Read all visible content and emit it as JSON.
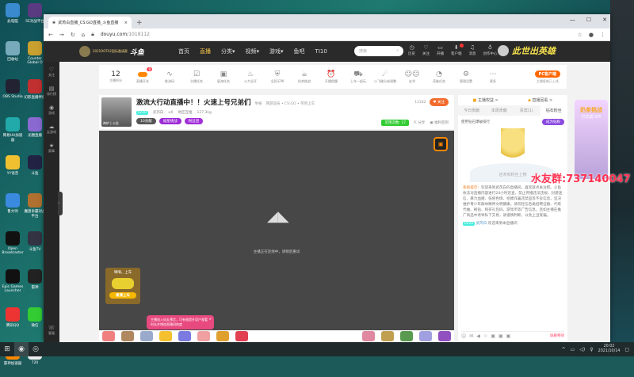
{
  "desktop": {
    "icons": [
      "此电脑",
      "5E对战平台",
      "回收站",
      "Counter Global O",
      "OBS Studio",
      "幻影直播伴侣",
      "网易UU加速器",
      "光圈直播",
      "YY语音",
      "斗鱼",
      "鲁大师",
      "魔兽争霸对战平台",
      "Open Broadcaster",
      "斗鱼TV",
      "Epic Games Launcher",
      "雷神",
      "腾讯QQ",
      "微信",
      "雷神加速器",
      "720"
    ]
  },
  "browser": {
    "tab_title": "武芮白直播_CS:GO直播_斗鱼直播",
    "url_domain": "douyu.com",
    "url_path": "/1019112",
    "new_tab": "+"
  },
  "site": {
    "nav": [
      "首页",
      "直播",
      "分类",
      "视频",
      "游戏",
      "鱼吧",
      "TI10"
    ],
    "logo_text": "2021DOTA2国际邀请赛",
    "logo_brand": "斗鱼",
    "search_placeholder": "搜索",
    "user_icons": [
      "历史",
      "关注",
      "开播",
      "客户端",
      "消息",
      "创作中心"
    ],
    "brand_slogan": "此世出英雄",
    "side": [
      "关注",
      "排行榜",
      "游戏",
      "云游戏",
      "赛事",
      "客服"
    ],
    "toolbar": {
      "score": "12",
      "score_label": "主播积分",
      "toggle_badge": "9",
      "items": [
        "直播开关",
        "推流码",
        "主播任务",
        "星海任务",
        "火力全开",
        "全民乐PK",
        "奶茶挑战",
        "开播提醒",
        "上车一起玩",
        "小飞碟分成调整",
        "友邻",
        "亮能任务",
        "管理设置",
        "更多"
      ],
      "pc_button": "PC客户端",
      "pc_sub": "主播版制已上线"
    }
  },
  "room": {
    "title": "激流大行动直播中！！火速上号兄弟们",
    "report": "举报",
    "category": "网游竞技 • CS:GO • 带到上车",
    "level": "LV20",
    "streamer": "武芮白",
    "hot": "0",
    "rank": "地区互推",
    "weight": "127.3kg",
    "fans_count": "12182",
    "follow": "关注",
    "thumb_label": "神护 | 公告",
    "tags": [
      "10贡献",
      "福星挑战",
      "粉丝团"
    ],
    "chance": "可用次数: 17",
    "share": "分享",
    "client": "福利签到"
  },
  "video": {
    "status": "主播正在连线中，请稍后重试",
    "car_title": "嘀嘀，上车",
    "car_btn": "邀请上车",
    "tip": "主播加入仙丸预言，可有效提升用户观看时长并增加直播间热度"
  },
  "panel": {
    "top": [
      "主播权益 >",
      "直播回看 >"
    ],
    "tabs": [
      "今日贡献",
      "本周贡献",
      "贵宾(1)",
      "钻石粉丝"
    ],
    "rank_label": "使用钻石爆破排行",
    "rank_btn": "成为钻粉",
    "empty": "还未有粉丝上榜",
    "chat": {
      "sys_label": "系统提示：",
      "sys_text": "欢迎来到武芮白的直播间。喜欢就点关注吧。斗鱼依法对直播内容进行24小时巡查，禁止传播违法违规、封建迷信、暴力血腥、低俗色情、招嫖诈骗违禁品等不良信息，坚决维护青少年群体精神文明健康。请勿轻信各类招聘征婚、代练代抽、刷钻、购买礼包码、游戏币等广告信息，且如主播在推广商品中诱导私下交易，请谨慎判断，以免上当受骗。",
      "user_level": "LV20",
      "user": "武芮白",
      "user_text": "欢迎来到本直播间"
    },
    "report": "屏蔽特效"
  },
  "banner": {
    "title": "奶茶挑战",
    "sub": "已达成 0/5"
  },
  "watermark": "水友群:737140047",
  "taskbar": {
    "time": "20:02",
    "date": "2021/10/14"
  }
}
